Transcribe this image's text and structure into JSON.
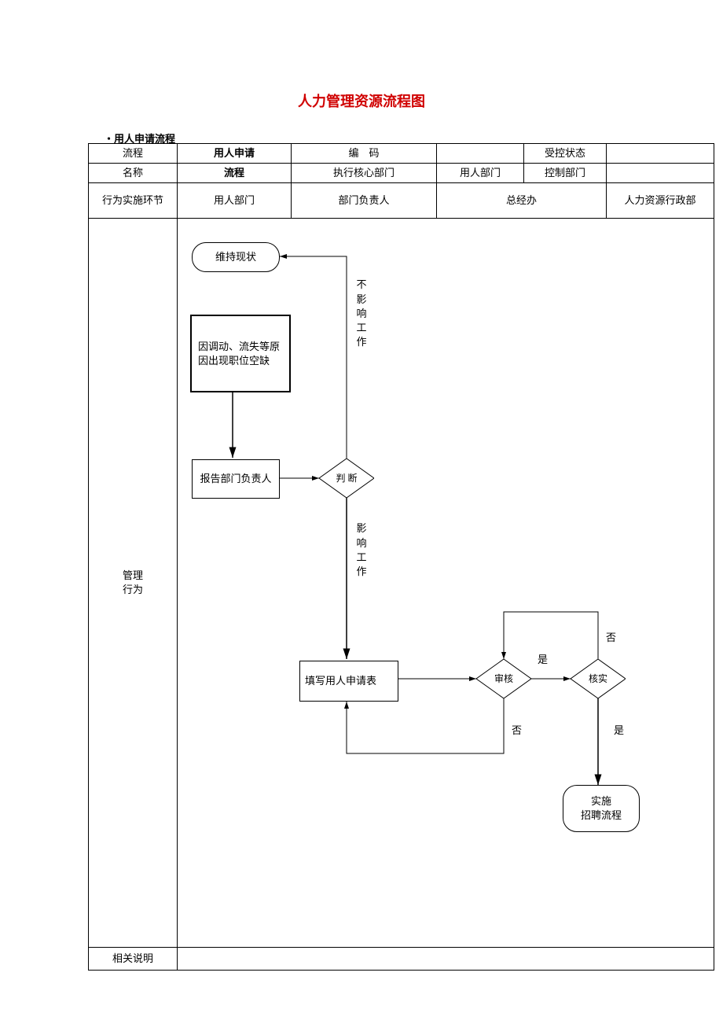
{
  "title": "人力管理资源流程图",
  "subtitle": "・用人申请流程",
  "header": {
    "r1c1": "流程",
    "r1c2": "用人申请",
    "r1c3": "编　码",
    "r1c4": "",
    "r1c5": "受控状态",
    "r1c6": "",
    "r2c1": "名称",
    "r2c2": "流程",
    "r2c3": "执行核心部门",
    "r2c4": "用人部门",
    "r2c5": "控制部门",
    "r2c6": ""
  },
  "lanes": {
    "label": "行为实施环节",
    "c1": "用人部门",
    "c2": "部门负责人",
    "c3": "总经办",
    "c4": "人力资源行政部"
  },
  "rowlabels": {
    "mgmt": "管理\n行为",
    "notes": "相关说明"
  },
  "nodes": {
    "keep": "维持现状",
    "cause": "因调动、流失等原因出现职位空缺",
    "report": "报告部门负责人",
    "judge": "判 断",
    "fill": "填写用人申请表",
    "review": "审核",
    "verify": "核实",
    "recruit": "实施\n招聘流程"
  },
  "edge_labels": {
    "no_effect": "不影响工作",
    "effect": "影响工作",
    "yes1": "是",
    "no1": "否",
    "yes2": "是",
    "no2": "否"
  }
}
